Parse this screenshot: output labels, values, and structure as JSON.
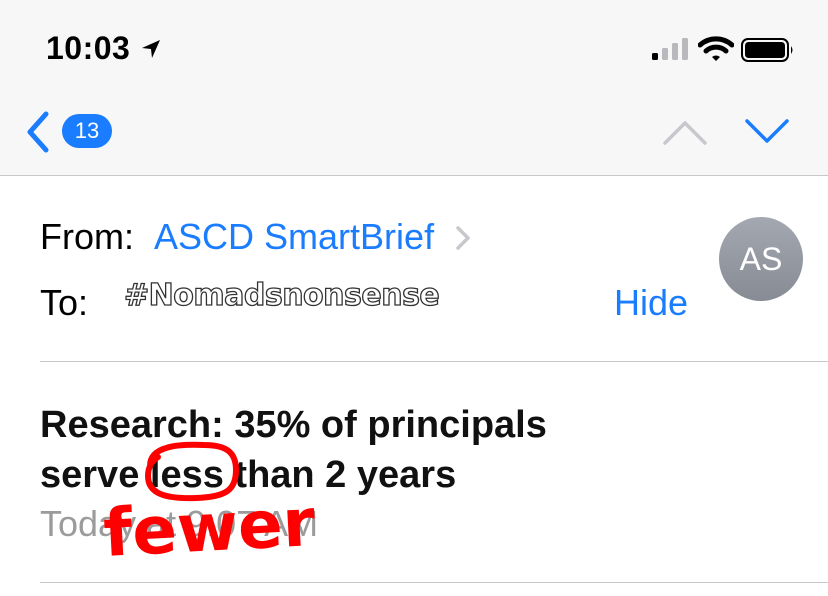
{
  "status_bar": {
    "time": "10:03"
  },
  "nav": {
    "back_count": "13"
  },
  "message": {
    "from_label": "From:",
    "sender": "ASCD SmartBrief",
    "to_label": "To:",
    "redaction_tag": "#Nomadsnonsense",
    "hide_label": "Hide",
    "avatar_initials": "AS",
    "subject_line1": "Research: 35% of principals",
    "subject_line2_before": "serve ",
    "subject_line2_circled": "less",
    "subject_line2_after": " than 2 years",
    "date": "Today at 9:07 AM"
  },
  "annotation": {
    "handwritten_text": "fewer",
    "color": "#ff0000"
  },
  "colors": {
    "accent": "#1a7cff",
    "avatar": "#8e9299"
  }
}
